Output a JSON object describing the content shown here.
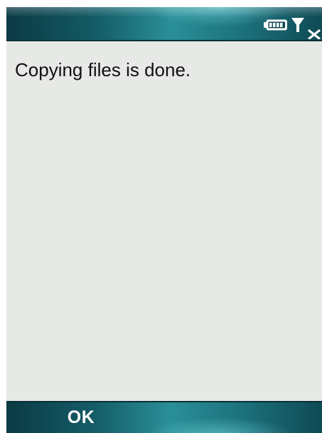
{
  "status_bar": {
    "battery_icon": "battery-icon",
    "signal_icon": "signal-no-service-icon"
  },
  "content": {
    "message": "Copying files is done."
  },
  "softkeys": {
    "left_label": "OK",
    "right_label": ""
  },
  "colors": {
    "bar_dark": "#0b3a44",
    "bar_accent": "#2a8f98",
    "content_background": "#e7e9e6"
  }
}
